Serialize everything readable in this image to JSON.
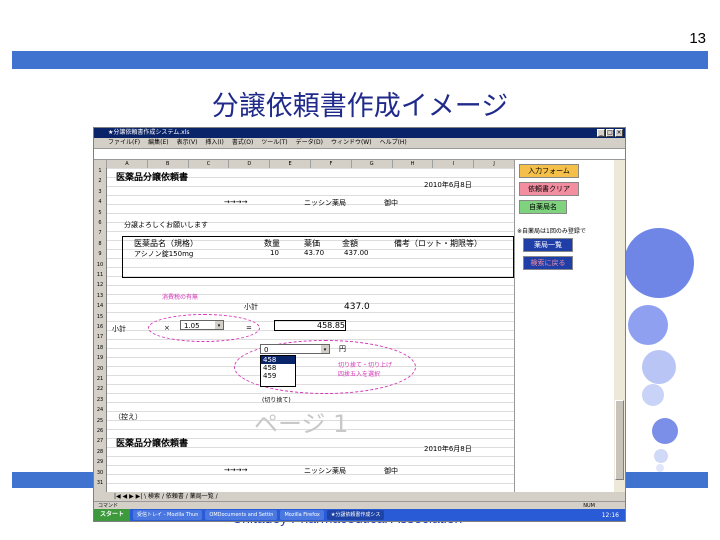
{
  "slide": {
    "number": "13",
    "title": "分譲依頼書作成イメージ",
    "footer": "Chitadey Pharmaceutical Association"
  },
  "window": {
    "title": "★分譲依頼書作成システム.xls",
    "menu": [
      "ファイル(F)",
      "編集(E)",
      "表示(V)",
      "挿入(I)",
      "書式(O)",
      "ツール(T)",
      "データ(D)",
      "ウィンドウ(W)",
      "ヘルプ(H)"
    ],
    "columns": [
      "A",
      "B",
      "C",
      "D",
      "E",
      "F",
      "G",
      "H",
      "I",
      "J",
      "K",
      "L",
      "M"
    ],
    "rows": [
      "1",
      "2",
      "3",
      "4",
      "5",
      "6",
      "7",
      "8",
      "9",
      "10",
      "11",
      "12",
      "13",
      "14",
      "15",
      "16",
      "17",
      "18",
      "19",
      "20",
      "21",
      "22",
      "23",
      "24",
      "25",
      "26",
      "27",
      "28",
      "29",
      "30",
      "31"
    ]
  },
  "sheet": {
    "form_title": "医薬品分譲依頼書",
    "date": "2010年6月8日",
    "arrow": "→→→→",
    "pharmacy": "ニッシン薬局",
    "honorific": "御中",
    "request_text": "分譲よろしくお願いします",
    "headers": {
      "name": "医薬品名（規格）",
      "qty": "数量",
      "price": "薬価",
      "amount": "金額",
      "note": "備考（ロット・期限等）"
    },
    "item": {
      "name": "アシノン錠150mg",
      "qty": "10",
      "price": "43.70",
      "amount": "437.00"
    },
    "consumption_tax_label": "消費税の有無",
    "subtotal_label": "小計",
    "subtotal_value": "437.0",
    "total_label": "小計",
    "times": "×",
    "tax_rate": "1.05",
    "equals": "=",
    "total_value": "458.85",
    "round_value": "0",
    "yen": "円",
    "round_options": [
      "458",
      "458",
      "459"
    ],
    "round_note_1": "切り捨て・切り上げ",
    "round_note_2": "四捨五入を選択",
    "round_cut_label": "(切り捨て)",
    "page_watermark": "ページ 1",
    "copy_label": "（控え）",
    "form_title_2": "医薬品分譲依頼書",
    "date_2": "2010年6月8日",
    "arrow_2": "→→→→",
    "pharmacy_2": "ニッシン薬局",
    "honorific_2": "御中"
  },
  "panel": {
    "input_form": "入力フォーム",
    "clear": "依頼書クリア",
    "drug_name": "自薬局名",
    "note": "※自薬局は1回のみ登録で",
    "list": "薬局一覧",
    "back": "検索に戻る"
  },
  "tabs": {
    "text": "|◀ ◀ ▶ ▶| \\ 検索 / 依頼書 / 薬局一覧 /"
  },
  "status": {
    "ready": "コマンド",
    "num": "NUM"
  },
  "taskbar": {
    "start": "スタート",
    "tasks": [
      "受信トレイ - Mozilla Thun",
      "OMDocuments and Settin",
      "Mozilla Firefox",
      "★分譲依頼書作成シス"
    ],
    "clock": "12:16"
  },
  "colors": {
    "accent": "#3f73cf",
    "title": "#1f2a8a",
    "magenta": "#d633b8",
    "panel_orange": "#f5c04a",
    "panel_pink": "#f28ea0",
    "panel_green": "#7fd37f",
    "panel_blue": "#1f3ea8"
  }
}
